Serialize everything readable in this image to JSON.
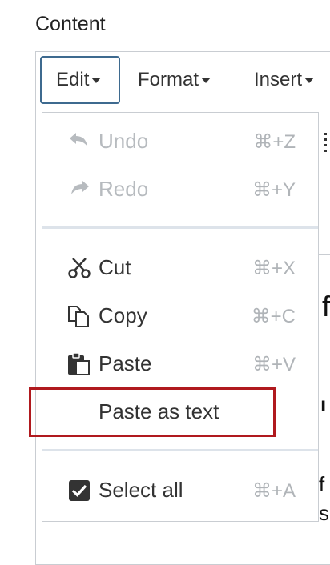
{
  "field_label": "Content",
  "menubar": [
    {
      "label": "Edit",
      "active": true
    },
    {
      "label": "Format",
      "active": false
    },
    {
      "label": "Insert",
      "active": false
    }
  ],
  "menu": {
    "undo": {
      "label": "Undo",
      "shortcut": "⌘+Z",
      "icon": "undo-icon"
    },
    "redo": {
      "label": "Redo",
      "shortcut": "⌘+Y",
      "icon": "redo-icon"
    },
    "cut": {
      "label": "Cut",
      "shortcut": "⌘+X",
      "icon": "scissors-icon"
    },
    "copy": {
      "label": "Copy",
      "shortcut": "⌘+C",
      "icon": "copy-icon"
    },
    "paste": {
      "label": "Paste",
      "shortcut": "⌘+V",
      "icon": "clipboard-icon"
    },
    "paste_text": {
      "label": "Paste as text"
    },
    "select_all": {
      "label": "Select all",
      "shortcut": "⌘+A",
      "icon": "checkbox-icon"
    }
  },
  "colors": {
    "highlight": "#b0191e",
    "active_border": "#3e6a8f",
    "disabled": "#b7bbbf"
  }
}
